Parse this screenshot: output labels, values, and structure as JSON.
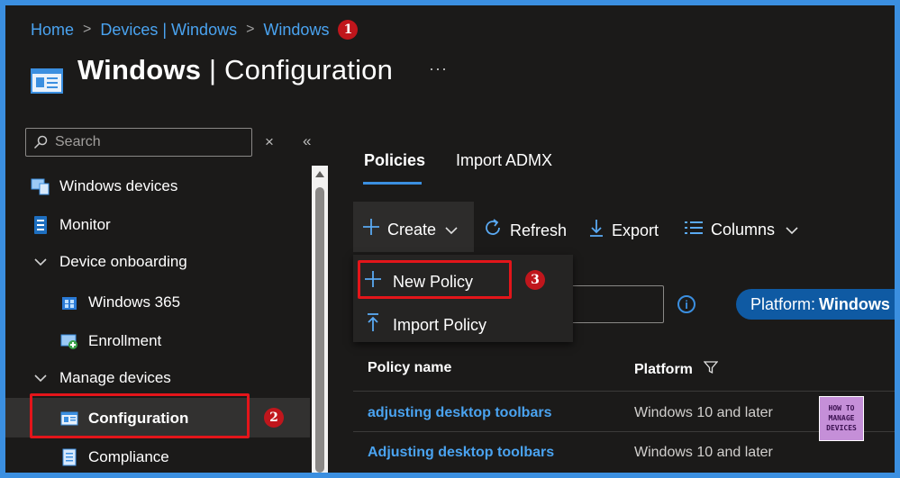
{
  "breadcrumb": {
    "items": [
      "Home",
      "Devices | Windows",
      "Windows"
    ],
    "separator": ">"
  },
  "markers": [
    "1",
    "2",
    "3"
  ],
  "header": {
    "title_bold": "Windows",
    "title_rest": " | Configuration",
    "more": "···"
  },
  "sidebar": {
    "search_placeholder": "Search",
    "close_glyph": "×",
    "collapse_glyph": "«",
    "items": [
      {
        "label": "Windows devices",
        "icon": "windows-devices-icon"
      },
      {
        "label": "Monitor",
        "icon": "monitor-icon"
      },
      {
        "label": "Device onboarding",
        "icon": "chevron-down-icon"
      },
      {
        "label": "Windows 365",
        "icon": "windows-365-icon"
      },
      {
        "label": "Enrollment",
        "icon": "enrollment-icon"
      },
      {
        "label": "Manage devices",
        "icon": "chevron-down-icon"
      },
      {
        "label": "Configuration",
        "icon": "configuration-icon"
      },
      {
        "label": "Compliance",
        "icon": "compliance-icon"
      }
    ]
  },
  "tabs": [
    "Policies",
    "Import ADMX"
  ],
  "toolbar": {
    "create": "Create",
    "refresh": "Refresh",
    "export": "Export",
    "columns": "Columns"
  },
  "create_menu": {
    "new_policy": "New Policy",
    "import_policy": "Import Policy"
  },
  "filter": {
    "pill_prefix": "Platform:",
    "pill_value": "Windows"
  },
  "table": {
    "headers": [
      "Policy name",
      "Platform"
    ],
    "rows": [
      {
        "name": "adjusting desktop toolbars",
        "platform": "Windows 10 and later"
      },
      {
        "name": "Adjusting desktop toolbars",
        "platform": "Windows 10 and later"
      }
    ]
  },
  "watermark": {
    "line1": "HOW TO",
    "line2": "MANAGE",
    "line3": "DEVICES"
  },
  "colors": {
    "accent": "#3b8fe0",
    "link": "#4aa3f0",
    "highlight_box": "#e3151a",
    "background": "#1b1a19"
  }
}
